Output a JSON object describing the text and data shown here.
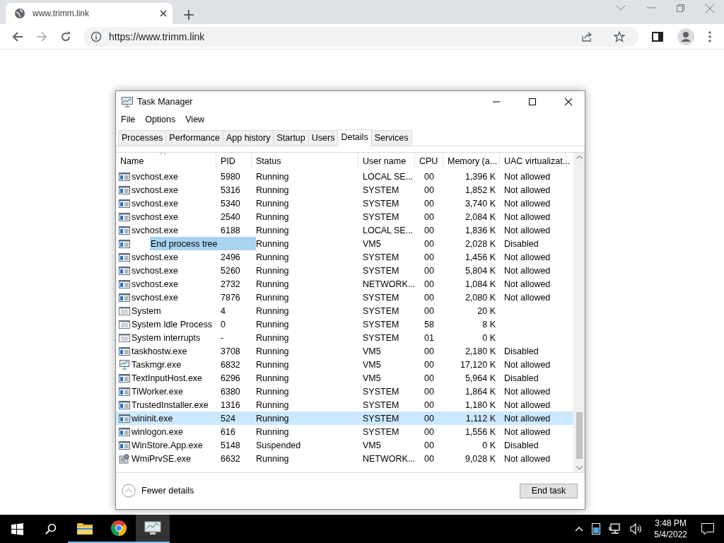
{
  "browser": {
    "tab_title": "www.trimm.link",
    "url": "https://www.trimm.link"
  },
  "window": {
    "title": "Task Manager"
  },
  "menu": [
    "File",
    "Options",
    "View"
  ],
  "tabs": [
    {
      "label": "Processes",
      "selected": false
    },
    {
      "label": "Performance",
      "selected": false
    },
    {
      "label": "App history",
      "selected": false
    },
    {
      "label": "Startup",
      "selected": false
    },
    {
      "label": "Users",
      "selected": false
    },
    {
      "label": "Details",
      "selected": true
    },
    {
      "label": "Services",
      "selected": false
    }
  ],
  "table": {
    "columns": [
      "Name",
      "PID",
      "Status",
      "User name",
      "CPU",
      "Memory (a...",
      "UAC virtualizat..."
    ],
    "rows": [
      {
        "kind": "service",
        "name": "svchost.exe",
        "pid": "5980",
        "status": "Running",
        "user": "LOCAL SE...",
        "cpu": "00",
        "memory": "1,396 K",
        "uac": "Not allowed",
        "selected": false
      },
      {
        "kind": "service",
        "name": "svchost.exe",
        "pid": "5316",
        "status": "Running",
        "user": "SYSTEM",
        "cpu": "00",
        "memory": "1,852 K",
        "uac": "Not allowed",
        "selected": false
      },
      {
        "kind": "service",
        "name": "svchost.exe",
        "pid": "5340",
        "status": "Running",
        "user": "SYSTEM",
        "cpu": "00",
        "memory": "3,740 K",
        "uac": "Not allowed",
        "selected": false
      },
      {
        "kind": "service",
        "name": "svchost.exe",
        "pid": "2540",
        "status": "Running",
        "user": "SYSTEM",
        "cpu": "00",
        "memory": "2,084 K",
        "uac": "Not allowed",
        "selected": false
      },
      {
        "kind": "service",
        "name": "svchost.exe",
        "pid": "6188",
        "status": "Running",
        "user": "LOCAL SE...",
        "cpu": "00",
        "memory": "1,836 K",
        "uac": "Not allowed",
        "selected": false
      },
      {
        "kind": "service",
        "status": "Running",
        "user": "VM5",
        "cpu": "00",
        "memory": "2,028 K",
        "uac": "Disabled",
        "selected": false
      },
      {
        "kind": "service",
        "name": "svchost.exe",
        "pid": "2496",
        "status": "Running",
        "user": "SYSTEM",
        "cpu": "00",
        "memory": "1,456 K",
        "uac": "Not allowed",
        "selected": false
      },
      {
        "kind": "service",
        "name": "svchost.exe",
        "pid": "5260",
        "status": "Running",
        "user": "SYSTEM",
        "cpu": "00",
        "memory": "5,804 K",
        "uac": "Not allowed",
        "selected": false
      },
      {
        "kind": "service",
        "name": "svchost.exe",
        "pid": "2732",
        "status": "Running",
        "user": "NETWORK...",
        "cpu": "00",
        "memory": "1,084 K",
        "uac": "Not allowed",
        "selected": false
      },
      {
        "kind": "service",
        "name": "svchost.exe",
        "pid": "7876",
        "status": "Running",
        "user": "SYSTEM",
        "cpu": "00",
        "memory": "2,080 K",
        "uac": "Not allowed",
        "selected": false
      },
      {
        "kind": "system",
        "name": "System",
        "pid": "4",
        "status": "Running",
        "user": "SYSTEM",
        "cpu": "00",
        "memory": "20 K",
        "selected": false
      },
      {
        "kind": "system",
        "name": "System Idle Process",
        "pid": "0",
        "status": "Running",
        "user": "SYSTEM",
        "cpu": "58",
        "memory": "8 K",
        "selected": false
      },
      {
        "kind": "system",
        "name": "System interrupts",
        "pid": "-",
        "status": "Running",
        "user": "SYSTEM",
        "cpu": "01",
        "memory": "0 K",
        "selected": false
      },
      {
        "kind": "service",
        "name": "taskhostw.exe",
        "pid": "3708",
        "status": "Running",
        "user": "VM5",
        "cpu": "00",
        "memory": "2,180 K",
        "uac": "Disabled",
        "selected": false
      },
      {
        "kind": "monitor",
        "name": "Taskmgr.exe",
        "pid": "6832",
        "status": "Running",
        "user": "VM5",
        "cpu": "00",
        "memory": "17,120 K",
        "uac": "Not allowed",
        "selected": false
      },
      {
        "kind": "service",
        "name": "TextInputHost.exe",
        "pid": "6296",
        "status": "Running",
        "user": "VM5",
        "cpu": "00",
        "memory": "5,964 K",
        "uac": "Disabled",
        "selected": false
      },
      {
        "kind": "service",
        "name": "TiWorker.exe",
        "pid": "6380",
        "status": "Running",
        "user": "SYSTEM",
        "cpu": "00",
        "memory": "1,864 K",
        "uac": "Not allowed",
        "selected": false
      },
      {
        "kind": "service",
        "name": "TrustedInstaller.exe",
        "pid": "1316",
        "status": "Running",
        "user": "SYSTEM",
        "cpu": "00",
        "memory": "1,180 K",
        "uac": "Not allowed",
        "selected": false
      },
      {
        "kind": "service",
        "name": "wininit.exe",
        "pid": "524",
        "status": "Running",
        "user": "SYSTEM",
        "cpu": "00",
        "memory": "1,112 K",
        "uac": "Not allowed",
        "selected": true
      },
      {
        "kind": "service",
        "name": "winlogon.exe",
        "pid": "616",
        "status": "Running",
        "user": "SYSTEM",
        "cpu": "00",
        "memory": "1,556 K",
        "uac": "Not allowed",
        "selected": false
      },
      {
        "kind": "service",
        "name": "WinStore.App.exe",
        "pid": "5148",
        "status": "Suspended",
        "user": "VM5",
        "cpu": "00",
        "memory": "0 K",
        "uac": "Disabled",
        "selected": false
      },
      {
        "kind": "wmi",
        "name": "WmiPrvSE.exe",
        "pid": "6632",
        "status": "Running",
        "user": "NETWORK...",
        "cpu": "00",
        "memory": "9,028 K",
        "uac": "Not allowed",
        "selected": false
      }
    ]
  },
  "drag_label": "End process tree",
  "footer": {
    "toggle": "Fewer details",
    "button": "End task"
  },
  "taskbar": {
    "time": "3:48 PM",
    "date": "5/4/2022"
  }
}
